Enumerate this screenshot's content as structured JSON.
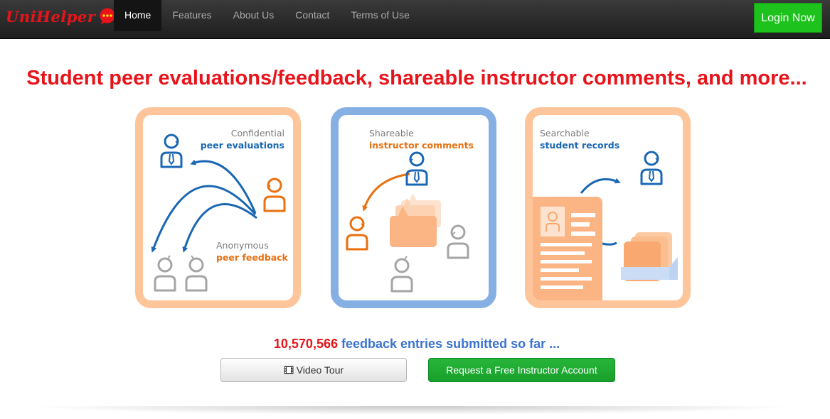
{
  "brand": {
    "name": "UniHelper",
    "icon": "speech-bubble-icon"
  },
  "nav": {
    "items": [
      {
        "label": "Home",
        "active": true
      },
      {
        "label": "Features",
        "active": false
      },
      {
        "label": "About Us",
        "active": false
      },
      {
        "label": "Contact",
        "active": false
      },
      {
        "label": "Terms of Use",
        "active": false
      }
    ],
    "login_label": "Login Now"
  },
  "headline": "Student peer evaluations/feedback, shareable instructor comments, and more...",
  "panels": [
    {
      "line1": "Confidential",
      "line2": "peer evaluations",
      "line3": "Anonymous",
      "line4": "peer feedback"
    },
    {
      "line1": "Shareable",
      "line2": "instructor comments"
    },
    {
      "line1": "Searchable",
      "line2": "student records"
    }
  ],
  "stats": {
    "count": "10,570,566",
    "label": "feedback entries submitted so far ..."
  },
  "buttons": {
    "tour_label": "Video Tour",
    "tour_icon": "film-icon",
    "request_label": "Request a Free Instructor Account"
  },
  "colors": {
    "brand_red": "#e8141b",
    "login_green": "#1dc21d",
    "accent_blue": "#1a67b4",
    "accent_orange": "#e8700f",
    "panel_peach": "#ffc59a",
    "panel_blue": "#86b0e4"
  }
}
